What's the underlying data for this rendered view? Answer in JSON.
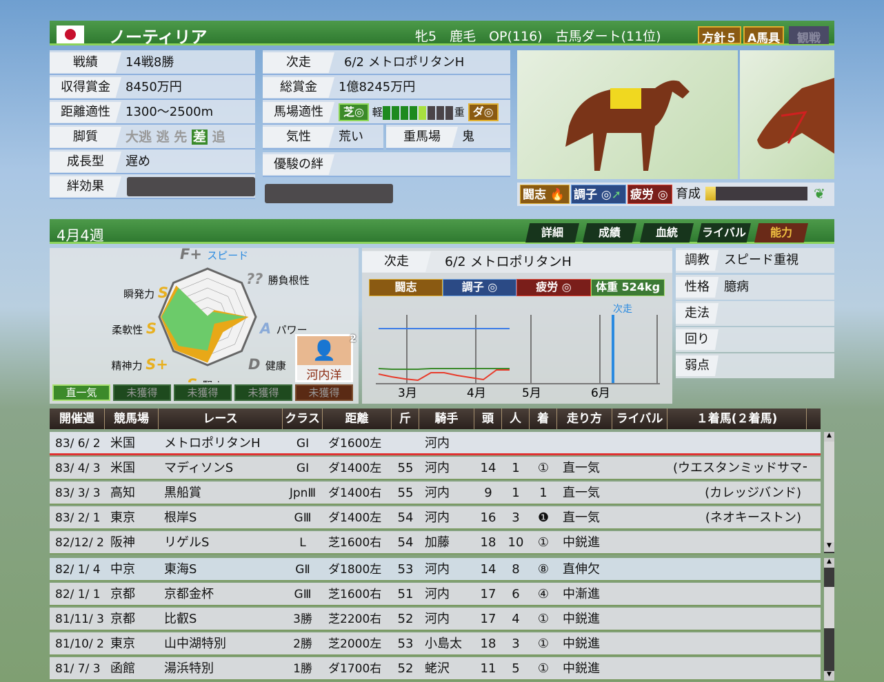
{
  "header": {
    "horse_name": "ノーティリア",
    "info": "牝5　鹿毛　OP(116)　古馬ダート(11位)",
    "badges": [
      "方針５",
      "A馬具",
      "観戦"
    ]
  },
  "info_left": [
    {
      "label": "戦績",
      "value": "14戦8勝"
    },
    {
      "label": "収得賞金",
      "value": "8450万円"
    },
    {
      "label": "距離適性",
      "value": "1300〜2500m"
    },
    {
      "label": "脚質",
      "styles": [
        "大逃",
        "逃",
        "先",
        "差",
        "追"
      ],
      "active": "差"
    },
    {
      "label": "成長型",
      "value": "遅め"
    },
    {
      "label": "絆効果"
    }
  ],
  "info_mid": {
    "next_race": {
      "label": "次走",
      "value": "6/2  メトロポリタンH"
    },
    "total_prize": {
      "label": "総賞金",
      "value": "1億8245万円"
    },
    "track": {
      "label": "馬場適性",
      "turf": "芝◎",
      "light": "軽",
      "heavy": "重",
      "dirt": "ダ◎",
      "level": 5,
      "segments": 8
    },
    "temper": {
      "label": "気性",
      "value": "荒い"
    },
    "heavy_track": {
      "label": "重馬場",
      "value": "鬼"
    },
    "bond": {
      "label": "優駿の絆"
    }
  },
  "status": {
    "fight": "闘志",
    "condition": "調子 ◎",
    "fatigue": "疲労 ◎",
    "training_label": "育成",
    "training_progress": 0.1
  },
  "section": {
    "week": "4月4週",
    "tabs": [
      "詳細",
      "成績",
      "血統",
      "ライバル",
      "能力"
    ],
    "active_tab": "能力"
  },
  "radar": {
    "axes": [
      {
        "name": "スピード",
        "grade": "F+",
        "value": 0.02,
        "max": 0.02
      },
      {
        "name": "勝負根性",
        "grade": "??",
        "value": 0.15,
        "max": 0.2
      },
      {
        "name": "パワー",
        "grade": "A",
        "value": 0.8,
        "max": 0.85
      },
      {
        "name": "健康",
        "grade": "D",
        "value": 0.2,
        "max": 0.45
      },
      {
        "name": "賢さ",
        "grade": "S",
        "value": 0.7,
        "max": 0.95
      },
      {
        "name": "精神力",
        "grade": "S+",
        "value": 0.85,
        "max": 0.97
      },
      {
        "name": "柔軟性",
        "grade": "S",
        "value": 0.95,
        "max": 0.97
      },
      {
        "name": "瞬発力",
        "grade": "S",
        "value": 0.85,
        "max": 0.92
      }
    ],
    "jockey": "河内洋",
    "jockey_badge": "2",
    "skills": [
      "直一気",
      "未獲得",
      "未獲得",
      "未獲得",
      "未獲得"
    ]
  },
  "chart_panel": {
    "next_label": "次走",
    "next_value": "6/2  メトロポリタンH",
    "pills": [
      "闘志",
      "調子 ◎",
      "疲労 ◎",
      "体重 524kg"
    ],
    "next_marker": "次走",
    "months": [
      "3月",
      "4月",
      "5月",
      "6月"
    ],
    "series": {
      "blue": [
        80,
        80,
        80,
        80,
        80,
        80,
        80,
        80,
        80,
        80,
        80
      ],
      "green": [
        22,
        21,
        21,
        21,
        22,
        22,
        22,
        22,
        22,
        22,
        22
      ],
      "red": [
        14,
        10,
        7,
        5,
        16,
        16,
        12,
        9,
        6,
        20,
        20
      ]
    }
  },
  "right_panel": [
    {
      "label": "調教",
      "value": "スピード重視"
    },
    {
      "label": "性格",
      "value": "臆病"
    },
    {
      "label": "走法",
      "value": ""
    },
    {
      "label": "回り",
      "value": ""
    },
    {
      "label": "弱点",
      "value": ""
    }
  ],
  "table": {
    "headers": [
      "開催週",
      "競馬場",
      "レース",
      "クラス",
      "距離",
      "斤",
      "騎手",
      "頭",
      "人",
      "着",
      "走り方",
      "ライバル",
      "１着馬(２着馬)"
    ],
    "rows": [
      [
        "83/ 6/ 2",
        "米国",
        "メトロポリタンH",
        "GⅠ",
        "ダ1600左",
        "",
        "河内",
        "",
        "",
        "",
        "",
        "",
        ""
      ],
      [
        "83/ 4/ 3",
        "米国",
        "マディソンS",
        "GⅠ",
        "ダ1400左",
        "55",
        "河内",
        "14",
        "1",
        "①",
        "直一気",
        "",
        "(ウエスタンミッドサマー)"
      ],
      [
        "83/ 3/ 3",
        "高知",
        "黒船賞",
        "JpnⅢ",
        "ダ1400右",
        "55",
        "河内",
        "9",
        "1",
        "1",
        "直一気",
        "",
        "(カレッジバンド)"
      ],
      [
        "83/ 2/ 1",
        "東京",
        "根岸S",
        "GⅢ",
        "ダ1400左",
        "54",
        "河内",
        "16",
        "3",
        "❶",
        "直一気",
        "",
        "(ネオキーストン)"
      ],
      [
        "82/12/ 2",
        "阪神",
        "リゲルS",
        "L",
        "芝1600右",
        "54",
        "加藤",
        "18",
        "10",
        "①",
        "中鋭進",
        "",
        ""
      ],
      [
        "82/ 1/ 4",
        "中京",
        "東海S",
        "GⅡ",
        "ダ1800左",
        "53",
        "河内",
        "14",
        "8",
        "⑧",
        "直伸欠",
        "",
        ""
      ],
      [
        "82/ 1/ 1",
        "京都",
        "京都金杯",
        "GⅢ",
        "芝1600右",
        "51",
        "河内",
        "17",
        "6",
        "④",
        "中漸進",
        "",
        ""
      ],
      [
        "81/11/ 3",
        "京都",
        "比叡S",
        "3勝",
        "芝2200右",
        "52",
        "河内",
        "17",
        "4",
        "①",
        "中鋭進",
        "",
        ""
      ],
      [
        "81/10/ 2",
        "東京",
        "山中湖特別",
        "2勝",
        "芝2000左",
        "53",
        "小島太",
        "18",
        "3",
        "①",
        "中鋭進",
        "",
        ""
      ],
      [
        "81/ 7/ 3",
        "函館",
        "湯浜特別",
        "1勝",
        "ダ1700右",
        "52",
        "蛯沢",
        "11",
        "5",
        "①",
        "中鋭進",
        "",
        ""
      ]
    ]
  },
  "colors": {
    "header_green": "#2f7a30",
    "fight": "#8a5a12",
    "condition": "#2b4a85",
    "fatigue": "#7a1e1a",
    "weight": "#3c7a35",
    "radar_fill": "#6ccb6a",
    "radar_max": "#e8a818"
  }
}
